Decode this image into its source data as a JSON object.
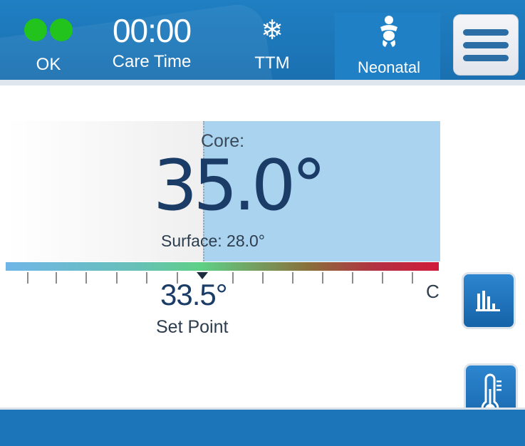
{
  "header": {
    "status": {
      "label": "OK",
      "indicator_color": "#22c31c",
      "icon": "status-dots-icon"
    },
    "care_time": {
      "value": "00:00",
      "label": "Care Time"
    },
    "ttm": {
      "label": "TTM",
      "icon": "snowflake-icon",
      "glyph": "❄"
    },
    "mode": {
      "label": "Neonatal",
      "icon": "baby-icon"
    },
    "menu": {
      "icon": "hamburger-menu-icon"
    }
  },
  "temperature": {
    "core_label": "Core:",
    "core_value": "35.0°",
    "surface": "Surface: 28.0°",
    "set_point_value": "33.5°",
    "set_point_label": "Set Point",
    "unit": "C"
  },
  "side_buttons": {
    "chart": {
      "icon": "bar-chart-icon"
    },
    "thermometer": {
      "icon": "thermometer-icon"
    }
  },
  "colors": {
    "header_blue": "#1a6fb0",
    "footer_blue": "#1c74b9",
    "panel_blue": "#a9d3ef",
    "text_dark": "#1a3c66"
  }
}
